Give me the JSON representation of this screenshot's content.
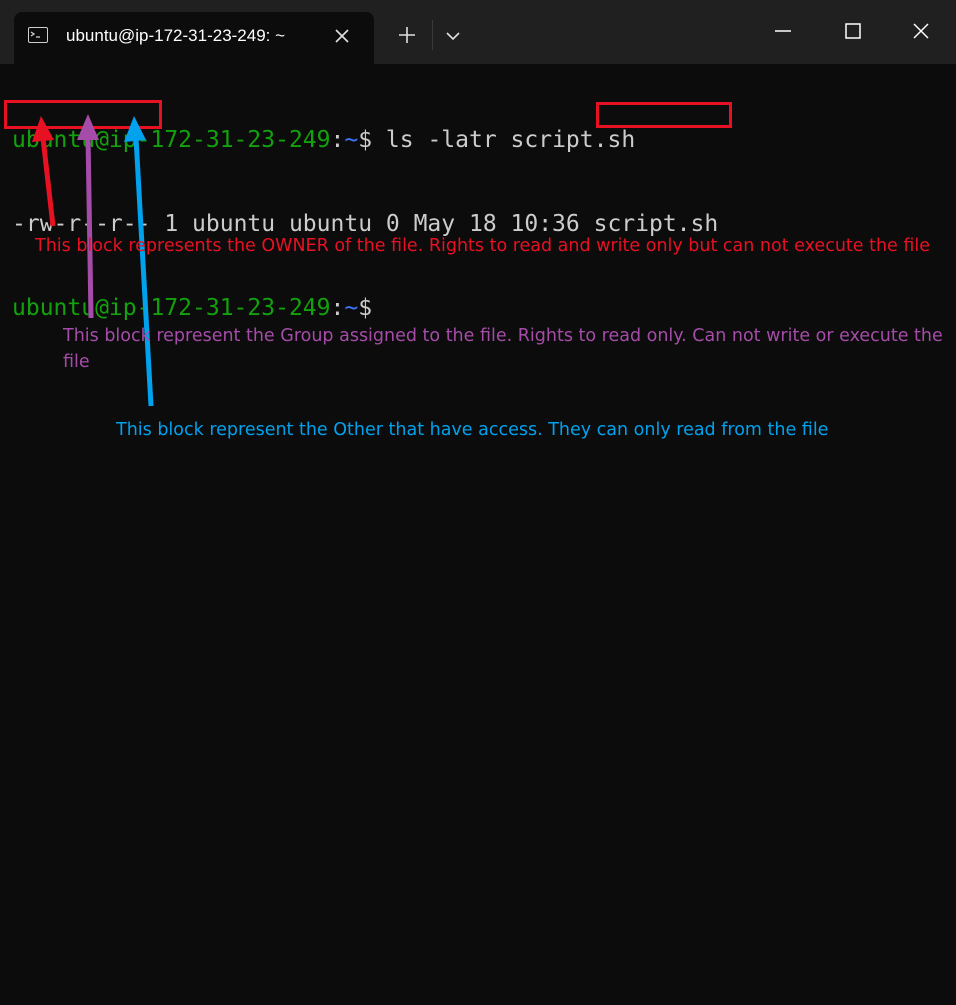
{
  "window": {
    "tab_title": "ubuntu@ip-172-31-23-249: ~"
  },
  "terminal": {
    "line1": {
      "user_host": "ubuntu@ip-172-31-23-249",
      "colon": ":",
      "path": "~",
      "prompt": "$ ",
      "command": "ls -latr script.sh"
    },
    "line2": {
      "permissions": "-rw-r--r--",
      "details": " 1 ubuntu ubuntu 0 May 18 10:36 ",
      "filename": "script.sh"
    },
    "line3": {
      "user_host": "ubuntu@ip-172-31-23-249",
      "colon": ":",
      "path": "~",
      "prompt": "$"
    }
  },
  "annotations": {
    "owner": "This block represents the OWNER of the file. Rights to read and write only but can not execute the file",
    "group": "This block represent the Group assigned to the file. Rights to read only. Can not write or execute the file",
    "other": "This block represent the Other that have access. They can only read from the file"
  },
  "colors": {
    "background": "#0c0c0c",
    "prompt_green": "#13a10e",
    "path_blue": "#3b78ff",
    "owner_red": "#e81123",
    "group_purple": "#a54ca9",
    "other_blue": "#00a2ed"
  },
  "icons": {
    "tab": "terminal-icon",
    "close_tab": "close-icon",
    "new_tab": "plus-icon",
    "dropdown": "chevron-down-icon",
    "minimize": "minimize-icon",
    "maximize": "maximize-icon",
    "close_window": "close-icon"
  }
}
